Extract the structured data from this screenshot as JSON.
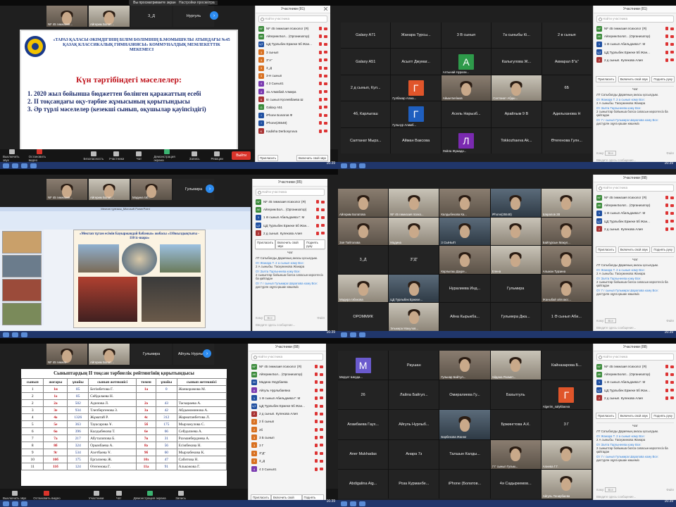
{
  "colors": {
    "zoom_blue": "#2d8cf0",
    "leave_red": "#d9342b",
    "slide_red": "#c0141c",
    "slide_blue": "#1a3a8a"
  },
  "clock": {
    "time": "16:39",
    "date": "08.05.2021"
  },
  "zoombar": {
    "mute": "Выключить звук",
    "video": "Остановить видео",
    "security": "Безопасность",
    "participants": "Участники",
    "participants_count": "83",
    "chat": "Чат",
    "share": "Демонстрация экрана",
    "record": "Запись",
    "reactions": "Реакции",
    "leave": "Выйти"
  },
  "q1": {
    "banner": "Вы просматриваете экран Айгерим Болат…",
    "view_options": "Настройки просмотра",
    "top_names": [
      "NF 45 гимназия…",
      "Айгерим Болат…",
      "3_Д",
      "Нургуль"
    ],
    "slide": {
      "header": "«ТАРАЗ ҚАЛАСЫ ӘКІМДІГІНІҢ БІЛІМ БӨЛІМІНІҢ Б.МОМЫШҰЛЫ АТЫНДАҒЫ №45 ҚАЗАҚ КЛАССИКАЛЫҚ ГИМНАЗИЯСЫ» КОММУНАЛДЫҚ МЕМЛЕКЕТТІК МЕКЕМЕСІ",
      "agenda_title": "Күн тәртібіндегі мәселелер:",
      "items": [
        "2020 жыл бойынша бюджеттен бөлінген қаражаттың есебі",
        "II тоқсандағы оқу-тәрбие жұмысының қорытындысы",
        "Әр түрлі мәселелер (кезекші сынып, оқушылар қауіпсіздігі)"
      ]
    },
    "panel_title": "Участники (81)",
    "search": "Найти участника",
    "participants": [
      {
        "initial": "NF",
        "name": "NF 45 гимназия психолог (Я)",
        "color": "#3a8a3a"
      },
      {
        "initial": "АБ",
        "name": "Айгерим Бол... (Организатор)",
        "color": "#3a8a3a"
      },
      {
        "initial": "ЦТ",
        "name": "ЦД Турлыбек Ержеке 5б Жан...",
        "color": "#1f4fa0"
      },
      {
        "initial": "3",
        "name": "3 сынып",
        "color": "#d87020"
      },
      {
        "initial": "3",
        "name": "3\"А\"",
        "color": "#d87020"
      },
      {
        "initial": "3",
        "name": "3_Д",
        "color": "#d87020"
      },
      {
        "initial": "3",
        "name": "3-Н сынып",
        "color": "#d87020"
      },
      {
        "initial": "4",
        "name": "4 3 Сынып1",
        "color": "#7a3ab0"
      },
      {
        "initial": "4",
        "name": "4а Алмабай Алмира",
        "color": "#7a3ab0"
      },
      {
        "initial": "6",
        "name": "6г сынып Күсеевбаева Ш",
        "color": "#a83232"
      },
      {
        "initial": "G",
        "name": "Galaxy A51",
        "color": "#3a8a3a"
      },
      {
        "initial": "I",
        "name": "iPhone Болатов Ф",
        "color": "#1f4fa0"
      },
      {
        "initial": "I",
        "name": "iPhone(25548)",
        "color": "#1f4fa0"
      },
      {
        "initial": "K",
        "name": "Kadisha Dеrbosynova",
        "color": "#a83232"
      }
    ],
    "invite": "Пригласить",
    "mute_all": "Включить свой звук",
    "more": "Подн.руку"
  },
  "q2": {
    "tiles": [
      {
        "label": "Galaxy A71",
        "bg": "#232323",
        "initial": ""
      },
      {
        "label": "Жанара Турсы...",
        "bg": "#232323",
        "initial": ""
      },
      {
        "label": "3 В сынып",
        "bg": "#232323",
        "initial": ""
      },
      {
        "label": "7а сыныбы Кі...",
        "bg": "#232323",
        "initial": ""
      },
      {
        "label": "2 в сынып",
        "bg": "#232323",
        "initial": ""
      },
      {
        "label": "Galaxy A51",
        "bg": "#232323",
        "initial": ""
      },
      {
        "label": "Асылт Джумаг...",
        "bg": "#232323",
        "initial": ""
      },
      {
        "label": "Алтынай Нурали...",
        "bg": "#232323",
        "initial": "А",
        "ic": "#2e9a4a"
      },
      {
        "label": "Калыгулова Ж...",
        "bg": "#232323",
        "initial": ""
      },
      {
        "label": "Акмарал 8\"а\"",
        "bg": "#232323",
        "initial": ""
      },
      {
        "label": "2 д сынып, Кул...",
        "bg": "#232323",
        "initial": ""
      },
      {
        "label": "Гулбахар Алжа...",
        "bg": "#232323",
        "initial": "Г",
        "ic": "#e0552a"
      },
      {
        "label": "Айым Бегімов",
        "bg": "vid",
        "initial": ""
      },
      {
        "label": "Салтанат Абдш...",
        "bg": "vid2",
        "initial": ""
      },
      {
        "label": "6Б",
        "bg": "#232323",
        "initial": ""
      },
      {
        "label": "4б, Карлыгаш",
        "bg": "#232323",
        "initial": ""
      },
      {
        "label": "Гульнур Алимб...",
        "bg": "#232323",
        "initial": "Г",
        "ic": "#1f5fbf"
      },
      {
        "label": "Асель Нарызб...",
        "bg": "#232323",
        "initial": ""
      },
      {
        "label": "Арайлым 9 В",
        "bg": "#232323",
        "initial": ""
      },
      {
        "label": "Адильханова Н",
        "bg": "#232323",
        "initial": ""
      },
      {
        "label": "Салтанат Мырз...",
        "bg": "#232323",
        "initial": ""
      },
      {
        "label": "Айман Ваксова",
        "bg": "#232323",
        "initial": ""
      },
      {
        "label": "Лейла Жумади...",
        "bg": "#232323",
        "initial": "Л",
        "ic": "#7a2ab0"
      },
      {
        "label": "Tokkozhaeva Ak...",
        "bg": "#232323",
        "initial": ""
      },
      {
        "label": "Өтегенова Гулн...",
        "bg": "#232323",
        "initial": ""
      }
    ],
    "panel_title": "Участники (81)",
    "search": "Найти участника",
    "participants": [
      {
        "initial": "NF",
        "name": "NF 45 гимназия психолог (Я)",
        "color": "#3a8a3a"
      },
      {
        "initial": "АБ",
        "name": "Айгерим Болат... (Организатор)",
        "color": "#3a8a3a"
      },
      {
        "initial": "1",
        "name": "1 Ә сынып Абильдаева Г. М",
        "color": "#1f4fa0"
      },
      {
        "initial": "ЦТ",
        "name": "ЦД Турлыбек Ержеке 5б Жан...",
        "color": "#1f4fa0"
      },
      {
        "initial": "2",
        "name": "2 д сынып. Кулекова Алия",
        "color": "#a83232"
      }
    ],
    "invite": "Пригласить",
    "mute_all": "Включить свой звук",
    "more": "Поднять руку",
    "chat_title": "Чат",
    "chat": [
      {
        "from": "",
        "text": "ЛТ Сатыбалды Дарияның анасы қосылдым."
      },
      {
        "from": "От Жанара Т. 2 а сынып кому Все:",
        "text": "2 А сыныбы. Таскужинова Жанара"
      },
      {
        "from": "От Залта Таргынеева кому Все:",
        "text": "2 сыныптар бойынша болса сапасын көрсетесіз ба қайтадан"
      },
      {
        "from": "От 7 г сынып Гульмира Шарапова кому Все:",
        "text": "дистурлн оқуға қашан көшеміз"
      }
    ],
    "to_label": "Кому:",
    "to_value": "Все",
    "file": "Файл",
    "input": "Введите здесь сообщение..."
  },
  "q3": {
    "top_names": [
      "NF 45 гимназия…",
      "Айгерим Болат…",
      "Мадина Ізб…",
      "Гульмира"
    ],
    "ppt_title": "Мектап тұлғасы_Microsoft PowerPoint",
    "slide_title": "«Мектап тұтам есімін Бауыржандай бабамыз» жобасы «110жылдықтығы - 110 іс-шара»",
    "panel_title": "Участники (85)",
    "search": "Найти участника",
    "participants": [
      {
        "initial": "NF",
        "name": "NF 45 гимназия психолог (Я)",
        "color": "#3a8a3a"
      },
      {
        "initial": "АБ",
        "name": "Айгерим Бол... (Организатор)",
        "color": "#3a8a3a"
      },
      {
        "initial": "1",
        "name": "1 Ә сынып Абильдаева Г. М",
        "color": "#1f4fa0"
      },
      {
        "initial": "ЦТ",
        "name": "ЦД Турлыбек Ержеке 5б Жан...",
        "color": "#1f4fa0"
      },
      {
        "initial": "2",
        "name": "2 д сынып. Кулекова Алия",
        "color": "#a83232"
      }
    ],
    "invite": "Пригласить",
    "mute_all": "Включить свой звук",
    "more": "Поднять руку",
    "chat_title": "Чат",
    "chat": [
      {
        "from": "",
        "text": "ЛТ Сатыбалды Дарияның анасы қосылдым."
      },
      {
        "from": "От Жанара Т. 2 а сынып кому Все:",
        "text": "2 А сыныбы. Таскужинова Жанара"
      },
      {
        "from": "От Залта Таргынеева кому Все:",
        "text": "2 сыныптар бойынша болса сапасын көрсетесіз ба қайтадан"
      },
      {
        "from": "От 7 г сынып Гульмира Шарапова кому Все:",
        "text": "дистурлн оқуға қашан көшеміз"
      }
    ],
    "to_label": "Кому:",
    "to_value": "Все",
    "file": "Файл",
    "input": "Введите здесь сообщение..."
  },
  "q4": {
    "tiles": [
      {
        "label": "Айгерим Болатова",
        "bg": "vid"
      },
      {
        "label": "NF 45 гимназия психо...",
        "bg": "vid2"
      },
      {
        "label": "Калдыбекова Ка...",
        "bg": "vid"
      },
      {
        "label": "iPhone(25548)",
        "bg": "vid3"
      },
      {
        "label": "Шарапов 2В",
        "bg": "vid2"
      },
      {
        "label": "Зоя Тайтолова",
        "bg": "vid"
      },
      {
        "label": "Мадина",
        "bg": "vid2"
      },
      {
        "label": "3 СЫНЫП",
        "bg": "vid3"
      },
      {
        "label": "",
        "bg": "vid2"
      },
      {
        "label": "Байтурсын Макул...",
        "bg": "vid"
      },
      {
        "label": "3_Д",
        "bg": "#232323"
      },
      {
        "label": "3\"Д\"",
        "bg": "#232323"
      },
      {
        "label": "Карлыгаш Дауре...",
        "bg": "vid"
      },
      {
        "label": "Елена",
        "bg": "vid2"
      },
      {
        "label": "Альжан Турзина",
        "bg": "vid"
      },
      {
        "label": "Мадира Ізбакова",
        "bg": "vid2"
      },
      {
        "label": "ЦД Турлыбек Ержеке...",
        "bg": "vid3"
      },
      {
        "label": "Нуралиева Инд...",
        "bg": "#232323"
      },
      {
        "label": "Гульмира",
        "bg": "#232323"
      },
      {
        "label": "Жаныбай ойлоасс...",
        "bg": "vid"
      },
      {
        "label": "ОРОММИК",
        "bg": "#232323"
      },
      {
        "label": "Эльмира Макулов...",
        "bg": "vid2"
      },
      {
        "label": "Айна Кырыкба...",
        "bg": "#232323"
      },
      {
        "label": "Гульмера Джа...",
        "bg": "#232323"
      },
      {
        "label": "1 Ә сынып Аби...",
        "bg": "#232323"
      }
    ],
    "panel_title": "Участники (88)",
    "search": "Найти участника",
    "participants": [
      {
        "initial": "NF",
        "name": "NF 45 гимназия психолог (Я)",
        "color": "#3a8a3a"
      },
      {
        "initial": "АБ",
        "name": "Айгерим Болат... (Организатор)",
        "color": "#3a8a3a"
      },
      {
        "initial": "1",
        "name": "1 Ә сынып Абильдаева Г. М",
        "color": "#1f4fa0"
      },
      {
        "initial": "ЦТ",
        "name": "ЦД Турлыбек Ержеке 5б Жан...",
        "color": "#1f4fa0"
      },
      {
        "initial": "2",
        "name": "2 д сынып. Кулекова Алия",
        "color": "#a83232"
      }
    ],
    "invite": "Пригласить",
    "mute_all": "Включить свой звук",
    "more": "Поднять руку",
    "chat_title": "Чат",
    "chat": [
      {
        "from": "",
        "text": "ЛТ Сатыбалды Дарияның анасы қосылдым."
      },
      {
        "from": "От Жанара Т. 2 а сынып кому Все:",
        "text": "2 А сыныбы. Таскужинова Жанара"
      },
      {
        "from": "От Залта Таргынеева кому Все:",
        "text": "2 сыныптар бойынша болса сапасын көрсетесіз ба қайтадан"
      },
      {
        "from": "От 7 г сынып Гульмира Шарапова кому Все:",
        "text": "дистурлн оқуға қашан көшеміз"
      }
    ],
    "to_label": "Кому:",
    "to_value": "Все",
    "file": "Файл",
    "input": "Введите здесь сообщение..."
  },
  "q5": {
    "top_names": [
      "NF 45 гимназ…",
      "Айгерим Болат…",
      "Гульмира",
      "Айгуль Нурлыб…"
    ],
    "table_title": "Сыныптардың II тоқсан тәрбиелік рейтингінің қорытындысы",
    "headers": [
      "сынып",
      "жоғары",
      "ұпайы",
      "сынып жетекшісі",
      "төмен",
      "ұпайы",
      "сынып жетекшісі"
    ],
    "rows": [
      [
        "1",
        "1н",
        "85",
        "Бегімбетова Г.",
        "1а",
        "0",
        "Жанкорамова М."
      ],
      [
        "2",
        "1ә",
        "85",
        "Сейдалаева Н.",
        "",
        "",
        ""
      ],
      [
        "2",
        "2а",
        "502",
        "Адилова Л.",
        "2ә",
        "43",
        "Таскараева А."
      ],
      [
        "3",
        "3е",
        "934",
        "Тлепбергенова З.",
        "3а",
        "42",
        "Абдымоминова А."
      ],
      [
        "4",
        "4ә",
        "1326",
        "Жұматай Р.",
        "4с",
        "312",
        "Жарматанбетова Л."
      ],
      [
        "5",
        "5е",
        "363",
        "Тауасарова Ұ.",
        "5б",
        "175",
        "Мырзакулова С."
      ],
      [
        "6",
        "6о",
        "396",
        "Калдыбекова Т.",
        "6е",
        "66",
        "Сейдалиева А."
      ],
      [
        "7",
        "7а",
        "217",
        "Абуталипова Б.",
        "7в",
        "31",
        "Рахманбердиева А."
      ],
      [
        "8",
        "8б",
        "324",
        "Орымбаева А.",
        "8ә",
        "56",
        "Есімбекова Н."
      ],
      [
        "9",
        "9г",
        "534",
        "Ахетбаева Ұ.",
        "9б",
        "60",
        "Мырзабекова К."
      ],
      [
        "10",
        "10б",
        "175",
        "Ергалиева Ж.",
        "10з",
        "47",
        "Сабитова Н."
      ],
      [
        "11",
        "11б",
        "124",
        "Өтегенова Г.",
        "11а",
        "91",
        "Алькожова Г."
      ]
    ],
    "panel_title": "Участники (88)",
    "search": "Найти участника",
    "participants": [
      {
        "initial": "NF",
        "name": "NF 45 гимназия психолог (Я)",
        "color": "#3a8a3a"
      },
      {
        "initial": "АБ",
        "name": "Айгерим Бол... (Организатор)",
        "color": "#3a8a3a"
      },
      {
        "initial": "М",
        "name": "Мадина Умурбаева",
        "color": "#1f4fa0"
      },
      {
        "initial": "А",
        "name": "Айгуль Нурлыбаевна",
        "color": "#7a3ab0"
      },
      {
        "initial": "1",
        "name": "1 Ә сынып Абильдаева Г. М",
        "color": "#1f4fa0"
      },
      {
        "initial": "ЦТ",
        "name": "ЦД Турлыбек Ержеке 5б Жан...",
        "color": "#1f4fa0"
      },
      {
        "initial": "2",
        "name": "2 д сынып. Кулекова Алия",
        "color": "#a83232"
      },
      {
        "initial": "2",
        "name": "2 б сынып",
        "color": "#d87020"
      },
      {
        "initial": "2",
        "name": "2б",
        "color": "#d87020"
      },
      {
        "initial": "3",
        "name": "3 Б сынып",
        "color": "#d87020"
      },
      {
        "initial": "3",
        "name": "3 Г",
        "color": "#d87020"
      },
      {
        "initial": "3",
        "name": "3\"Д\"",
        "color": "#d87020"
      },
      {
        "initial": "3",
        "name": "3_Д",
        "color": "#d87020"
      },
      {
        "initial": "4",
        "name": "4 3 Сынып1",
        "color": "#7a3ab0"
      }
    ],
    "invite": "Пригласить",
    "mute_all": "Включить свой звук",
    "more": "Поднять руку"
  },
  "q6": {
    "tiles": [
      {
        "label": "Мерует Шерда...",
        "initial": "M",
        "ic": "#6a5acd"
      },
      {
        "label": "Раушан",
        "initial": ""
      },
      {
        "label": "Гульнар Байтул...",
        "initial": "",
        "bg": "vid"
      },
      {
        "label": "Айдана Рахмет...",
        "initial": "",
        "bg": "vid2"
      },
      {
        "label": "Кайназарова Б...",
        "initial": ""
      },
      {
        "label": "26",
        "initial": ""
      },
      {
        "label": "Лайла Байгул...",
        "initial": ""
      },
      {
        "label": "Омиралиева Гу...",
        "initial": ""
      },
      {
        "label": "Бахытгуль",
        "initial": ""
      },
      {
        "label": "Algerim_salykbaeva",
        "initial": "Г",
        "ic": "#e0552a"
      },
      {
        "label": "Агамбаева Гаух...",
        "initial": ""
      },
      {
        "label": "Айгуль Нурлыб...",
        "initial": ""
      },
      {
        "label": "Барбекова Жанна",
        "initial": "",
        "bg": "vid3"
      },
      {
        "label": "Бржингтова А.К.",
        "initial": ""
      },
      {
        "label": "3 Г",
        "initial": ""
      },
      {
        "label": "Aner Mukhadas",
        "initial": ""
      },
      {
        "label": "Анара 7з",
        "initial": ""
      },
      {
        "label": "Талшын Калды...",
        "initial": ""
      },
      {
        "label": "7 Г сынып Гульм...",
        "initial": "",
        "bg": "vid"
      },
      {
        "label": "Алиева Г.Г.",
        "initial": "",
        "bg": "vid2"
      },
      {
        "label": "Abdigalina Aig...",
        "initial": ""
      },
      {
        "label": "Роза Курманбе...",
        "initial": ""
      },
      {
        "label": "iPhone (Болатов...",
        "initial": ""
      },
      {
        "label": "4ә Садыркемов...",
        "initial": ""
      },
      {
        "label": "Айгуль Тенирбаева",
        "initial": "",
        "bg": "vid2"
      }
    ],
    "panel_title": "Участники (88)",
    "search": "Найти участника",
    "participants": [
      {
        "initial": "NF",
        "name": "NF 45 гимназия психолог (Я)",
        "color": "#3a8a3a"
      },
      {
        "initial": "АБ",
        "name": "Айгерим Болат... (Организатор)",
        "color": "#3a8a3a"
      },
      {
        "initial": "1",
        "name": "1 Ә сынып Абильдаева Г. М",
        "color": "#1f4fa0"
      },
      {
        "initial": "ЦТ",
        "name": "ЦД Турлыбек Ержеке 5б Жан...",
        "color": "#1f4fa0"
      },
      {
        "initial": "2",
        "name": "2 д сынып. Кулекова Алия",
        "color": "#a83232"
      }
    ],
    "invite": "Пригласить",
    "mute_all": "Включить свой звук",
    "more": "Поднять руку",
    "chat_title": "Чат",
    "chat": [
      {
        "from": "",
        "text": "ЛТ Сатыбалды Дарияның анасы қосылдым."
      },
      {
        "from": "От Жанара Т. 2 а сынып кому Все:",
        "text": "2 А сыныбы. Таскужинова Жанара"
      },
      {
        "from": "От Залта Таргынеева кому Все:",
        "text": "2 сыныптар бойынша болса сапасын көрсетесіз ба қайтадан"
      },
      {
        "from": "От 7 г сынып Гульмира Шарапова кому Все:",
        "text": "дистурлн оқуға қашан көшеміз"
      }
    ],
    "to_label": "Кому:",
    "to_value": "Все",
    "file": "Файл",
    "input": "Введите здесь сообщение..."
  }
}
